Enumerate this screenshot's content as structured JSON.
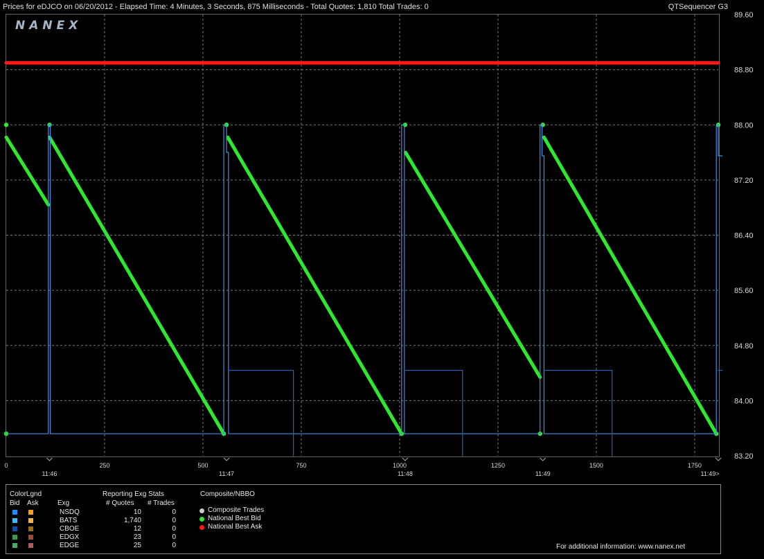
{
  "header": {
    "title": "Prices for  eDJCO  on  06/20/2012  -  Elapsed Time: 4 Minutes, 3 Seconds, 875 Milliseconds  -  Total Quotes: 1,810  Total Trades: 0",
    "app_name": "QTSequencer G3"
  },
  "logo_text": "NANEX",
  "chart_data": {
    "type": "line",
    "ylim": [
      83.2,
      89.6
    ],
    "xlim": [
      0,
      1810
    ],
    "y_ticks": [
      "89.60",
      "88.80",
      "88.00",
      "87.20",
      "86.40",
      "85.60",
      "84.80",
      "84.00",
      "83.20"
    ],
    "x_ticks": [
      "0",
      "250",
      "500",
      "750",
      "1000",
      "1250",
      "1500",
      "1750"
    ],
    "x_tick_values": [
      0,
      250,
      500,
      750,
      1000,
      1250,
      1500,
      1750
    ],
    "time_labels": [
      "11:46",
      "11:47",
      "11:48",
      "11:49",
      "11:49>"
    ],
    "time_label_positions": [
      110,
      560,
      1014,
      1364,
      1810
    ],
    "series": [
      {
        "name": "National Best Ask",
        "color": "#ff1a1a",
        "points": [
          [
            0,
            88.9
          ],
          [
            1810,
            88.9
          ]
        ]
      },
      {
        "name": "National Best Bid",
        "color": "#2ee82e",
        "segments": [
          [
            [
              0,
              87.82
            ],
            [
              107,
              86.84
            ]
          ],
          [
            [
              110,
              87.82
            ],
            [
              553,
              83.52
            ]
          ],
          [
            [
              563,
              87.82
            ],
            [
              1005,
              83.52
            ]
          ],
          [
            [
              1015,
              87.6
            ],
            [
              1357,
              84.34
            ]
          ],
          [
            [
              1367,
              87.82
            ],
            [
              1805,
              83.52
            ]
          ]
        ],
        "markers": [
          [
            0,
            88.0
          ],
          [
            110,
            88.0
          ],
          [
            560,
            88.0
          ],
          [
            1014,
            88.0
          ],
          [
            1364,
            88.0
          ],
          [
            1810,
            88.0
          ],
          [
            0,
            83.52
          ],
          [
            553,
            83.52
          ],
          [
            1005,
            83.52
          ],
          [
            1357,
            83.52
          ],
          [
            1805,
            83.52
          ]
        ]
      },
      {
        "name": "BATS",
        "color": "#3f8fe6",
        "points": [
          [
            0,
            83.52
          ],
          [
            107,
            83.52
          ],
          [
            107,
            88.0
          ],
          [
            112,
            88.0
          ],
          [
            112,
            83.52
          ],
          [
            553,
            83.52
          ],
          [
            553,
            88.0
          ],
          [
            560,
            88.0
          ],
          [
            560,
            87.6
          ],
          [
            565,
            87.6
          ],
          [
            565,
            83.52
          ],
          [
            1005,
            83.52
          ],
          [
            1005,
            88.0
          ],
          [
            1012,
            88.0
          ],
          [
            1012,
            83.52
          ],
          [
            1357,
            83.52
          ],
          [
            1357,
            88.0
          ],
          [
            1362,
            88.0
          ],
          [
            1362,
            87.55
          ],
          [
            1367,
            87.55
          ],
          [
            1367,
            83.52
          ],
          [
            1805,
            83.52
          ],
          [
            1805,
            88.0
          ],
          [
            1810,
            88.0
          ],
          [
            1810,
            87.55
          ],
          [
            1820,
            87.55
          ]
        ]
      },
      {
        "name": "NSDQ",
        "color": "#2a5fb0",
        "segments": [
          [
            [
              565,
              84.44
            ],
            [
              730,
              84.44
            ],
            [
              730,
              83.2
            ]
          ],
          [
            [
              1015,
              84.44
            ],
            [
              1160,
              84.44
            ],
            [
              1160,
              83.2
            ]
          ],
          [
            [
              1367,
              84.44
            ],
            [
              1540,
              84.44
            ],
            [
              1540,
              83.2
            ]
          ],
          [
            [
              1810,
              84.44
            ],
            [
              1820,
              84.44
            ]
          ]
        ]
      }
    ],
    "legend": {
      "color_title": "ColorLgnd",
      "bid_label": "Bid",
      "ask_label": "Ask",
      "exch_label": "Exg",
      "stats_title": "Reporting Exg Stats",
      "quotes_label": "# Quotes",
      "trades_label": "# Trades",
      "composite_title": "Composite/NBBO",
      "rows": [
        {
          "exchange": "NSDQ",
          "quotes": "10",
          "trades": "0",
          "bid_color": "#1e8cff",
          "ask_color": "#ff9a1a"
        },
        {
          "exchange": "BATS",
          "quotes": "1,740",
          "trades": "0",
          "bid_color": "#45b4f0",
          "ask_color": "#ffb040"
        },
        {
          "exchange": "CBOE",
          "quotes": "12",
          "trades": "0",
          "bid_color": "#1a4aa0",
          "ask_color": "#a06a10"
        },
        {
          "exchange": "EDGX",
          "quotes": "23",
          "trades": "0",
          "bid_color": "#3a9a5a",
          "ask_color": "#a04a3a"
        },
        {
          "exchange": "EDGE",
          "quotes": "25",
          "trades": "0",
          "bid_color": "#4aaa6a",
          "ask_color": "#b05a5a"
        }
      ],
      "composite_items": [
        {
          "label": "Composite Trades",
          "color": "#c8c8c8"
        },
        {
          "label": "National Best Bid",
          "color": "#2ee82e"
        },
        {
          "label": "National Best Ask",
          "color": "#ff1a1a"
        }
      ]
    }
  },
  "footer_text": "For additional information: www.nanex.net"
}
